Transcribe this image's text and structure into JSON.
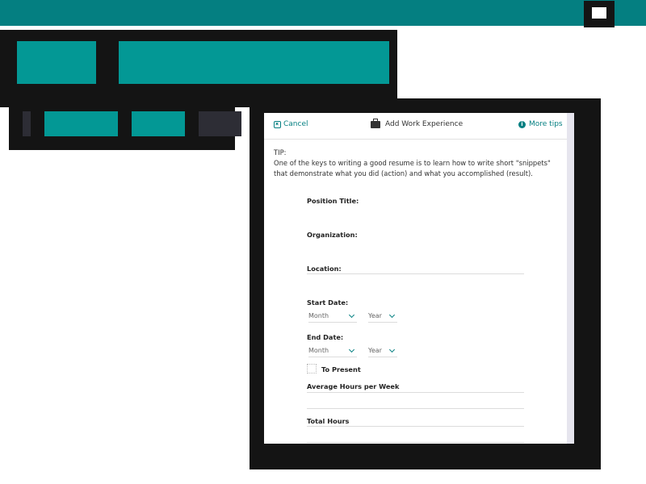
{
  "modal": {
    "cancel_label": "Cancel",
    "title": "Add Work Experience",
    "more_tips_label": "More tips",
    "tip": "TIP:\nOne of the keys to writing a good resume is to learn how to write short \"snippets\" that demonstrate what you did (action) and what you accomplished (result)."
  },
  "form": {
    "position_title_label": "Position Title:",
    "organization_label": "Organization:",
    "location_label": "Location:",
    "start_date_label": "Start Date:",
    "start_month": "Month",
    "start_year": "Year",
    "end_date_label": "End Date:",
    "end_month": "Month",
    "end_year": "Year",
    "to_present_label": "To Present",
    "avg_hours_label": "Average Hours per Week",
    "total_hours_label": "Total Hours"
  },
  "icons": {
    "cancel": "close-square-icon",
    "title": "briefcase-icon",
    "more_tips": "info-circle-icon",
    "select": "chevron-down-icon"
  },
  "colors": {
    "accent": "#047f81",
    "teal_block": "#039895",
    "overlay": "#141414"
  }
}
